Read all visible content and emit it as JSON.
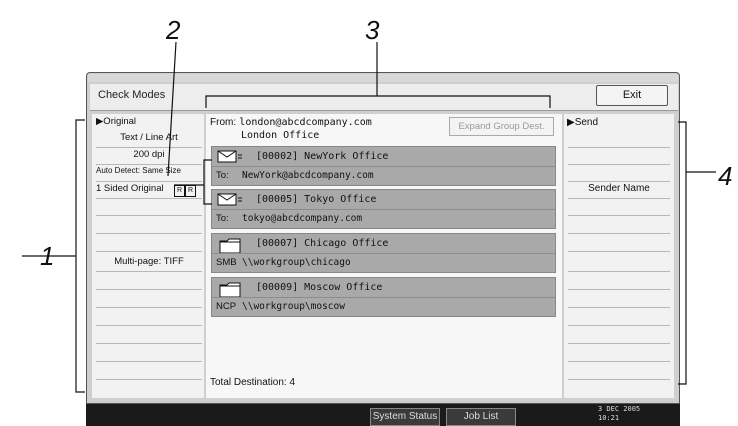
{
  "callouts": {
    "one": "1",
    "two": "2",
    "three": "3",
    "four": "4"
  },
  "screen": {
    "title": "Check Modes",
    "exit_label": "Exit"
  },
  "left": {
    "header": "▶Original",
    "rows": [
      "Text / Line Art",
      "200 dpi",
      "Auto Detect: Same Size",
      "1 Sided Original",
      "",
      "",
      "Multi-page: TIFF",
      "",
      "",
      "",
      "",
      "",
      ""
    ],
    "original_marks": [
      "R",
      "R"
    ]
  },
  "center": {
    "from_label": "From:",
    "from_email": "london@abcdcompany.com",
    "from_name": "London Office",
    "expand_button": "Expand Group Dest.",
    "destinations": [
      {
        "name": "[00002] NewYork Office",
        "type": "To:",
        "address": "NewYork@abcdcompany.com",
        "icon": "envelope-icon"
      },
      {
        "name": "[00005] Tokyo Office",
        "type": "To:",
        "address": "tokyo@abcdcompany.com",
        "icon": "envelope-icon"
      },
      {
        "name": "[00007] Chicago Office",
        "type": "SMB",
        "address": "\\\\workgroup\\chicago",
        "icon": "folder-icon"
      },
      {
        "name": "[00009] Moscow Office",
        "type": "NCP",
        "address": "\\\\workgroup\\moscow",
        "icon": "folder-icon"
      }
    ],
    "total": "Total Destination: 4"
  },
  "right": {
    "header": "▶Send",
    "sender_label": "Sender Name"
  },
  "bottom": {
    "system_status": "System Status",
    "job_list": "Job List",
    "date": "3 DEC  2005",
    "time": "10:21"
  },
  "colors": {
    "dest_bg": "#a9a9a9",
    "bottombar": "#1a1a1a",
    "panel": "#f2f2f2"
  }
}
